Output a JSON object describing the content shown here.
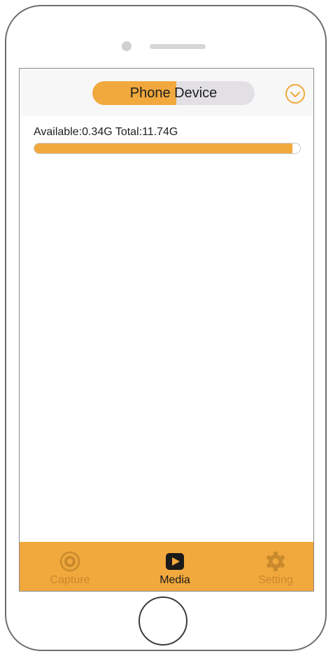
{
  "header": {
    "segment_label": "Phone Device"
  },
  "storage": {
    "text": "Available:0.34G Total:11.74G",
    "used_fraction": 0.97
  },
  "tabbar": {
    "tabs": [
      {
        "label": "Capture",
        "icon": "camera-lens-icon",
        "active": false
      },
      {
        "label": "Media",
        "icon": "play-icon",
        "active": true
      },
      {
        "label": "Setting",
        "icon": "gear-icon",
        "active": false
      }
    ]
  },
  "colors": {
    "accent": "#f1a83c",
    "segment_bg": "#e2e0e4",
    "tab_inactive": "#c98a2e"
  }
}
